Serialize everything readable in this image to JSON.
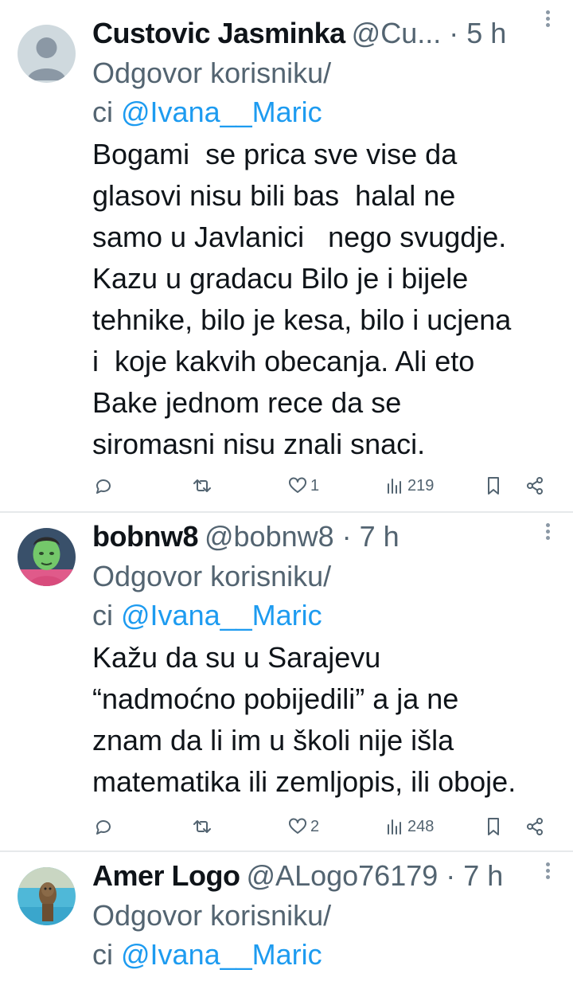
{
  "tweets": [
    {
      "name": "Custovic Jasminka",
      "handle_time": "@Cu... · 5 h",
      "reply_prefix_line1": "Odgovor korisniku/",
      "reply_prefix_line2": "ci ",
      "reply_mention": "@Ivana__Maric",
      "text": "Bogami  se prica sve vise da\nglasovi nisu bili bas  halal ne\nsamo u Javlanici   nego svugdje.\nKazu u gradacu Bilo je i bijele\ntehnike, bilo je kesa, bilo i ucjena\ni  koje kakvih obecanja. Ali eto\nBake jednom rece da se\nsiromasni nisu znali snaci.",
      "likes": "1",
      "views": "219"
    },
    {
      "name": "bobnw8",
      "handle_time": "@bobnw8 · 7 h",
      "reply_prefix_line1": "Odgovor korisniku/",
      "reply_prefix_line2": "ci ",
      "reply_mention": "@Ivana__Maric",
      "text": "Kažu da su u Sarajevu\n“nadmoćno pobijedili” a ja ne\nznam da li im u školi nije išla\nmatematika ili zemljopis, ili oboje.",
      "likes": "2",
      "views": "248"
    },
    {
      "name": "Amer Logo",
      "handle_time": "@ALogo76179 · 7 h",
      "reply_prefix_line1": "Odgovor korisniku/",
      "reply_prefix_line2": "ci ",
      "reply_mention": "@Ivana__Maric"
    }
  ],
  "icons": [
    "reply-icon",
    "retweet-icon",
    "like-icon",
    "views-icon",
    "bookmark-icon",
    "share-icon",
    "more-icon"
  ],
  "colors": {
    "mention": "#1d9bf0",
    "secondary": "#536471",
    "text": "#0f1419"
  }
}
